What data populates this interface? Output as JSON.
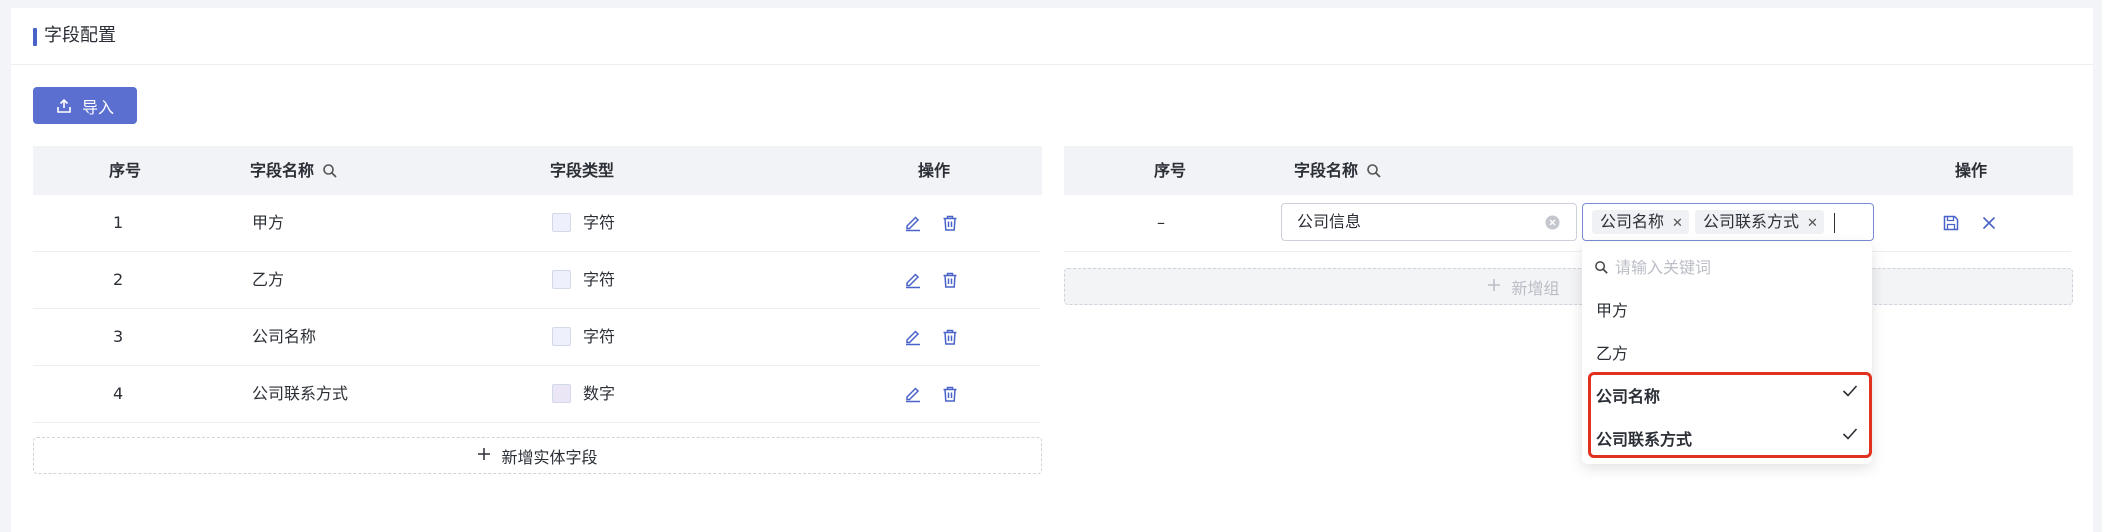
{
  "section": {
    "title": "字段配置"
  },
  "toolbar": {
    "import_label": "导入"
  },
  "left_table": {
    "headers": {
      "index": "序号",
      "name": "字段名称",
      "type": "字段类型",
      "action": "操作"
    },
    "rows": [
      {
        "index": "1",
        "name": "甲方",
        "type": "字符"
      },
      {
        "index": "2",
        "name": "乙方",
        "type": "字符"
      },
      {
        "index": "3",
        "name": "公司名称",
        "type": "字符"
      },
      {
        "index": "4",
        "name": "公司联系方式",
        "type": "数字"
      }
    ],
    "add_label": "新增实体字段"
  },
  "right_table": {
    "headers": {
      "index": "序号",
      "name": "字段名称",
      "action": "操作"
    },
    "row": {
      "index": "–",
      "name_value": "公司信息",
      "selected_tags": [
        "公司名称",
        "公司联系方式"
      ]
    },
    "add_label_visible": "新增组"
  },
  "dropdown": {
    "search_placeholder": "请输入关键词",
    "options": [
      {
        "label": "甲方",
        "selected": false
      },
      {
        "label": "乙方",
        "selected": false
      },
      {
        "label": "公司名称",
        "selected": true
      },
      {
        "label": "公司联系方式",
        "selected": true
      }
    ]
  },
  "colors": {
    "primary": "#5a6fd0",
    "highlight": "#e0321f",
    "header_bg": "#f2f3f6",
    "char_swatch": "#eef1fb",
    "number_swatch": "#ebe6f6"
  },
  "icons": [
    "upload-icon",
    "search-icon",
    "edit-icon",
    "delete-icon",
    "plus-icon",
    "clear-icon",
    "tag-close-icon",
    "save-icon",
    "close-icon",
    "check-icon"
  ]
}
